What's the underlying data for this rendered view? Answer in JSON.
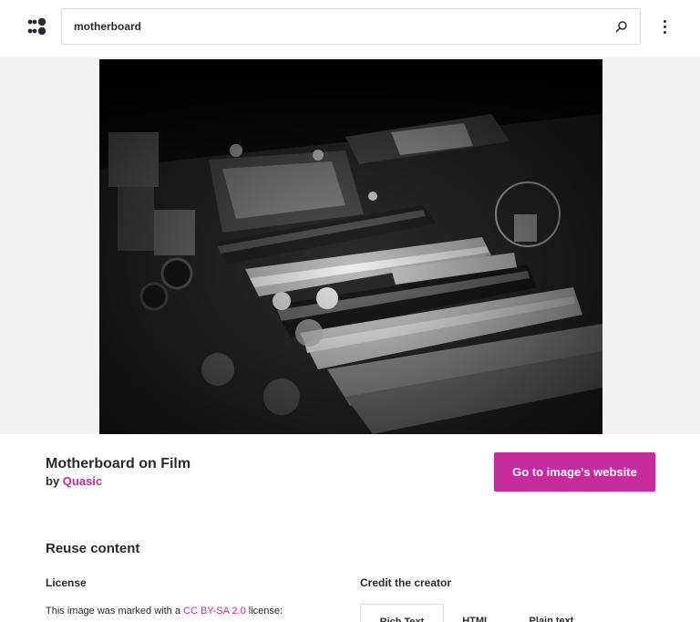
{
  "header": {
    "logo_icon": "openverse-logo-icon",
    "search_value": "motherboard",
    "search_icon": "search-icon",
    "menu_icon": "more-vertical-icon"
  },
  "image": {
    "subject": "motherboard photograph (black and white)"
  },
  "details": {
    "title": "Motherboard on Film",
    "by_prefix": "by",
    "creator": "Quasic",
    "go_button": "Go to image's website"
  },
  "reuse": {
    "heading": "Reuse content",
    "license_heading": "License",
    "license_text_before": "This image was marked with a ",
    "license_link": "CC BY-SA 2.0",
    "license_text_after": " license:",
    "credit_heading": "Credit the creator",
    "tabs": [
      "Rich Text",
      "HTML",
      "Plain text"
    ],
    "active_tab": "Rich Text"
  },
  "colors": {
    "accent": "#c52b9b",
    "text": "#30272e",
    "image_bg": "#f3f2f2"
  }
}
